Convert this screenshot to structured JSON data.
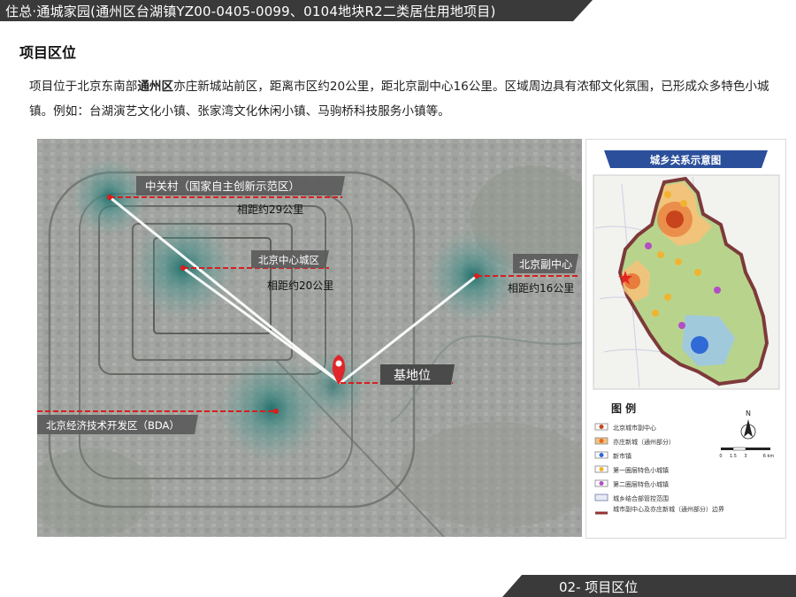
{
  "header": {
    "title": "住总·通城家园(通州区台湖镇YZ00-0405-0099、0104地块R2二类居住用地项目)"
  },
  "section": {
    "heading": "项目区位"
  },
  "intro": {
    "part1": "项目位于北京东南部",
    "bold": "通州区",
    "part2": "亦庄新城站前区，距离市区约20公里，距北京副中心16公里。区域周边具有浓郁文化氛围，已形成众多特色小城镇。例如：台湖演艺文化小镇、张家湾文化休闲小镇、马驹桥科技服务小镇等。"
  },
  "map": {
    "labels": {
      "zhongguancun": "中关村（国家自主创新示范区）",
      "dist_zgc": "相距约29公里",
      "core": "北京中心城区",
      "dist_core": "相距约20公里",
      "subcenter": "北京副中心",
      "dist_sub": "相距约16公里",
      "site": "基地位",
      "bda": "北京经济技术开发区（BDA）"
    },
    "colors": {
      "marker": "#e0262a",
      "dash": "#d81e1e",
      "label_bg": "#5b5b5b"
    }
  },
  "inset": {
    "title": "城乡关系示意图",
    "north": "N",
    "legend_title": "图  例",
    "legend_items": [
      "北京城市副中心",
      "亦庄新城（通州部分）",
      "新市镇",
      "第一圈层特色小城镇",
      "第二圈层特色小城镇",
      "城乡结合部管控范围",
      "城市副中心及亦庄新城（通州部分）边界"
    ],
    "scale_ticks": [
      "0",
      "1.5",
      "3",
      "6 km"
    ]
  },
  "footer": {
    "label": "02- 项目区位"
  }
}
